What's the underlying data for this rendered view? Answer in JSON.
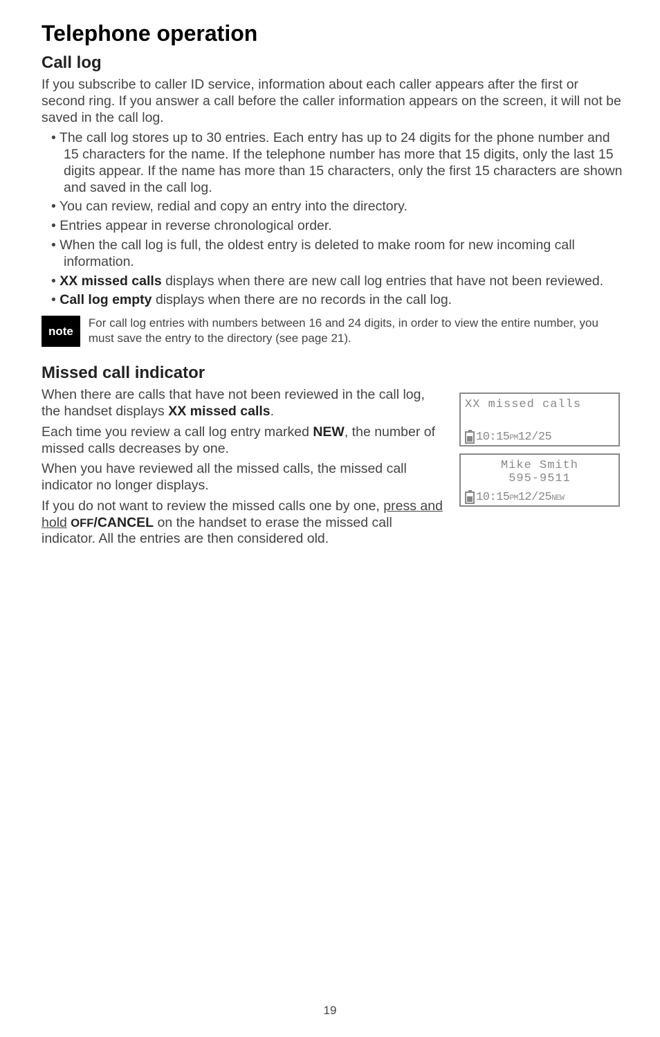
{
  "title": "Telephone operation",
  "section1": {
    "heading": "Call log",
    "intro": "If you subscribe to caller ID service, information about each caller appears after the first or second ring. If you answer a call before the caller information appears on the screen, it will not be saved in the call log.",
    "b1": "The call log stores up to 30 entries. Each entry has up to 24 digits for the phone number and 15 characters for the name. If the telephone number has more that 15 digits, only the last 15 digits appear. If the name has more than 15 characters, only the first 15 characters are shown and saved in the call log.",
    "b2": "You can review, redial and copy an entry into the directory.",
    "b3": "Entries appear in reverse chronological order.",
    "b4": "When the call log is full, the oldest entry is deleted to make room for new incoming call information.",
    "b5_bold": "XX missed calls",
    "b5_rest": " displays when there are new call log entries that have not been reviewed.",
    "b6_bold": "Call log empty",
    "b6_rest": " displays when there are no records in the call log."
  },
  "note": {
    "label": "note",
    "text": "For call log entries with numbers between 16 and 24 digits, in order to view the entire number, you must save the entry to the directory (see page 21)."
  },
  "section2": {
    "heading": "Missed call indicator",
    "p1_a": "When there are calls that have not been reviewed in the call log, the handset displays ",
    "p1_bold": "XX missed calls",
    "p1_b": ".",
    "p2_a": "Each time you review a call log entry marked ",
    "p2_bold": "NEW",
    "p2_b": ", the number of missed calls decreases by one.",
    "p3": "When you have reviewed all the missed calls, the missed call indicator no longer displays.",
    "p4_a": "If you do not want to review the missed calls one by one, ",
    "p4_u": "press and hold",
    "p4_b": " ",
    "p4_sc": "OFF",
    "p4_bold": "/CANCEL",
    "p4_c": " on the handset to erase the missed call indicator. All the entries are then considered old."
  },
  "screens": {
    "s1_line1": "XX missed calls",
    "s1_time_a": "10:15",
    "s1_time_pm": "PM",
    "s1_time_b": "12/25",
    "s2_name": "Mike Smith",
    "s2_num": "595-9511",
    "s2_time_a": "10:15",
    "s2_time_pm": "PM",
    "s2_time_b": "12/25",
    "s2_new": "NEW"
  },
  "page_number": "19"
}
